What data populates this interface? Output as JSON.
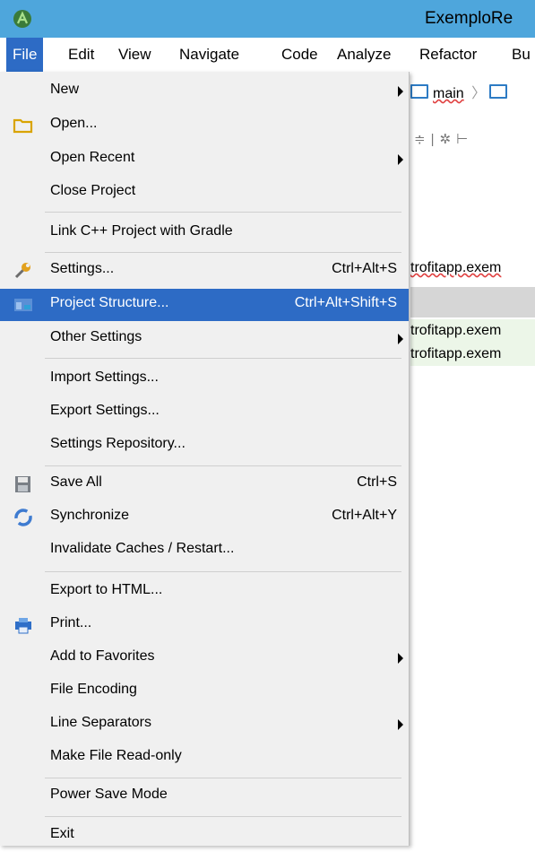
{
  "window": {
    "title": "ExemploRe"
  },
  "menubar": [
    "File",
    "Edit",
    "View",
    "Navigate",
    "Code",
    "Analyze",
    "Refactor",
    "Bu"
  ],
  "editor": {
    "crumb": "main",
    "code_line_1": "trofitapp.exem",
    "code_line_2": "trofitapp.exem",
    "code_line_3": "trofitapp.exem"
  },
  "file_menu": [
    {
      "label": "New",
      "shortcut": "",
      "submenu": true,
      "icon": ""
    },
    {
      "label": "Open...",
      "shortcut": "",
      "submenu": false,
      "icon": "folder-icon"
    },
    {
      "label": "Open Recent",
      "shortcut": "",
      "submenu": true,
      "icon": ""
    },
    {
      "label": "Close Project",
      "shortcut": "",
      "submenu": false,
      "icon": ""
    },
    {
      "label": "Link C++ Project with Gradle",
      "shortcut": "",
      "submenu": false,
      "icon": ""
    },
    {
      "label": "Settings...",
      "shortcut": "Ctrl+Alt+S",
      "submenu": false,
      "icon": "wrench-icon"
    },
    {
      "label": "Project Structure...",
      "shortcut": "Ctrl+Alt+Shift+S",
      "submenu": false,
      "icon": "project-structure-icon",
      "highlighted": true
    },
    {
      "label": "Other Settings",
      "shortcut": "",
      "submenu": true,
      "icon": ""
    },
    {
      "label": "Import Settings...",
      "shortcut": "",
      "submenu": false,
      "icon": ""
    },
    {
      "label": "Export Settings...",
      "shortcut": "",
      "submenu": false,
      "icon": ""
    },
    {
      "label": "Settings Repository...",
      "shortcut": "",
      "submenu": false,
      "icon": ""
    },
    {
      "label": "Save All",
      "shortcut": "Ctrl+S",
      "submenu": false,
      "icon": "save-icon"
    },
    {
      "label": "Synchronize",
      "shortcut": "Ctrl+Alt+Y",
      "submenu": false,
      "icon": "sync-icon"
    },
    {
      "label": "Invalidate Caches / Restart...",
      "shortcut": "",
      "submenu": false,
      "icon": ""
    },
    {
      "label": "Export to HTML...",
      "shortcut": "",
      "submenu": false,
      "icon": ""
    },
    {
      "label": "Print...",
      "shortcut": "",
      "submenu": false,
      "icon": "printer-icon"
    },
    {
      "label": "Add to Favorites",
      "shortcut": "",
      "submenu": true,
      "icon": ""
    },
    {
      "label": "File Encoding",
      "shortcut": "",
      "submenu": false,
      "icon": ""
    },
    {
      "label": "Line Separators",
      "shortcut": "",
      "submenu": true,
      "icon": ""
    },
    {
      "label": "Make File Read-only",
      "shortcut": "",
      "submenu": false,
      "icon": ""
    },
    {
      "label": "Power Save Mode",
      "shortcut": "",
      "submenu": false,
      "icon": ""
    },
    {
      "label": "Exit",
      "shortcut": "",
      "submenu": false,
      "icon": ""
    }
  ],
  "colors": {
    "titlebar": "#4ea6dc",
    "highlight": "#2d6bc5",
    "menu_bg": "#f0f0f0"
  }
}
